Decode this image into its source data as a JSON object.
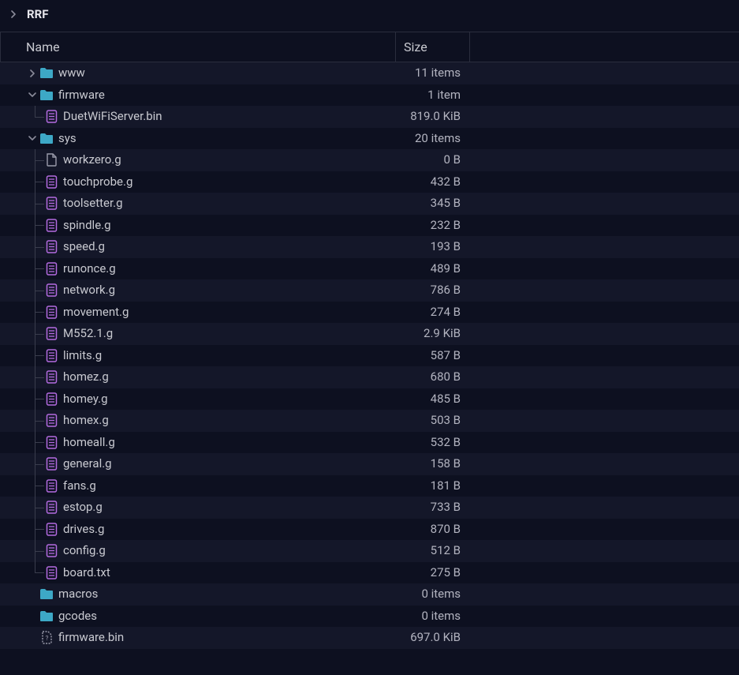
{
  "breadcrumb": {
    "title": "RRF"
  },
  "columns": {
    "name": "Name",
    "size": "Size"
  },
  "icons": {
    "folder": "folder-icon",
    "gcode": "gcode-file-icon",
    "blank": "blank-file-icon",
    "unknown": "unknown-file-icon",
    "chevron_right": "chevron-right-icon",
    "chevron_down": "chevron-down-icon"
  },
  "colors": {
    "folder": "#3da8c6",
    "gcode_border": "#b36be0",
    "file_outline": "#9a9bab"
  },
  "tree": [
    {
      "depth": 0,
      "arrow": "right",
      "icon": "folder",
      "name": "www",
      "size": "11 items",
      "last_at_depth": [],
      "continues": []
    },
    {
      "depth": 0,
      "arrow": "down",
      "icon": "folder",
      "name": "firmware",
      "size": "1 item",
      "last_at_depth": [],
      "continues": []
    },
    {
      "depth": 1,
      "arrow": "",
      "icon": "gcode",
      "name": "DuetWiFiServer.bin",
      "size": "819.0 KiB",
      "last_at_depth": [
        1
      ],
      "continues": [
        0
      ]
    },
    {
      "depth": 0,
      "arrow": "down",
      "icon": "folder",
      "name": "sys",
      "size": "20 items",
      "last_at_depth": [],
      "continues": []
    },
    {
      "depth": 1,
      "arrow": "",
      "icon": "blank",
      "name": "workzero.g",
      "size": "0 B",
      "last_at_depth": [],
      "continues": [
        0
      ]
    },
    {
      "depth": 1,
      "arrow": "",
      "icon": "gcode",
      "name": "touchprobe.g",
      "size": "432 B",
      "last_at_depth": [],
      "continues": [
        0
      ]
    },
    {
      "depth": 1,
      "arrow": "",
      "icon": "gcode",
      "name": "toolsetter.g",
      "size": "345 B",
      "last_at_depth": [],
      "continues": [
        0
      ]
    },
    {
      "depth": 1,
      "arrow": "",
      "icon": "gcode",
      "name": "spindle.g",
      "size": "232 B",
      "last_at_depth": [],
      "continues": [
        0
      ]
    },
    {
      "depth": 1,
      "arrow": "",
      "icon": "gcode",
      "name": "speed.g",
      "size": "193 B",
      "last_at_depth": [],
      "continues": [
        0
      ]
    },
    {
      "depth": 1,
      "arrow": "",
      "icon": "gcode",
      "name": "runonce.g",
      "size": "489 B",
      "last_at_depth": [],
      "continues": [
        0
      ]
    },
    {
      "depth": 1,
      "arrow": "",
      "icon": "gcode",
      "name": "network.g",
      "size": "786 B",
      "last_at_depth": [],
      "continues": [
        0
      ]
    },
    {
      "depth": 1,
      "arrow": "",
      "icon": "gcode",
      "name": "movement.g",
      "size": "274 B",
      "last_at_depth": [],
      "continues": [
        0
      ]
    },
    {
      "depth": 1,
      "arrow": "",
      "icon": "gcode",
      "name": "M552.1.g",
      "size": "2.9 KiB",
      "last_at_depth": [],
      "continues": [
        0
      ]
    },
    {
      "depth": 1,
      "arrow": "",
      "icon": "gcode",
      "name": "limits.g",
      "size": "587 B",
      "last_at_depth": [],
      "continues": [
        0
      ]
    },
    {
      "depth": 1,
      "arrow": "",
      "icon": "gcode",
      "name": "homez.g",
      "size": "680 B",
      "last_at_depth": [],
      "continues": [
        0
      ]
    },
    {
      "depth": 1,
      "arrow": "",
      "icon": "gcode",
      "name": "homey.g",
      "size": "485 B",
      "last_at_depth": [],
      "continues": [
        0
      ]
    },
    {
      "depth": 1,
      "arrow": "",
      "icon": "gcode",
      "name": "homex.g",
      "size": "503 B",
      "last_at_depth": [],
      "continues": [
        0
      ]
    },
    {
      "depth": 1,
      "arrow": "",
      "icon": "gcode",
      "name": "homeall.g",
      "size": "532 B",
      "last_at_depth": [],
      "continues": [
        0
      ]
    },
    {
      "depth": 1,
      "arrow": "",
      "icon": "gcode",
      "name": "general.g",
      "size": "158 B",
      "last_at_depth": [],
      "continues": [
        0
      ]
    },
    {
      "depth": 1,
      "arrow": "",
      "icon": "gcode",
      "name": "fans.g",
      "size": "181 B",
      "last_at_depth": [],
      "continues": [
        0
      ]
    },
    {
      "depth": 1,
      "arrow": "",
      "icon": "gcode",
      "name": "estop.g",
      "size": "733 B",
      "last_at_depth": [],
      "continues": [
        0
      ]
    },
    {
      "depth": 1,
      "arrow": "",
      "icon": "gcode",
      "name": "drives.g",
      "size": "870 B",
      "last_at_depth": [],
      "continues": [
        0
      ]
    },
    {
      "depth": 1,
      "arrow": "",
      "icon": "gcode",
      "name": "config.g",
      "size": "512 B",
      "last_at_depth": [],
      "continues": [
        0
      ]
    },
    {
      "depth": 1,
      "arrow": "",
      "icon": "gcode",
      "name": "board.txt",
      "size": "275 B",
      "last_at_depth": [
        1
      ],
      "continues": [
        0
      ]
    },
    {
      "depth": 0,
      "arrow": "none",
      "icon": "folder",
      "name": "macros",
      "size": "0 items",
      "last_at_depth": [],
      "continues": []
    },
    {
      "depth": 0,
      "arrow": "none",
      "icon": "folder",
      "name": "gcodes",
      "size": "0 items",
      "last_at_depth": [],
      "continues": []
    },
    {
      "depth": 0,
      "arrow": "none",
      "icon": "unknown",
      "name": "firmware.bin",
      "size": "697.0 KiB",
      "last_at_depth": [],
      "continues": []
    }
  ]
}
